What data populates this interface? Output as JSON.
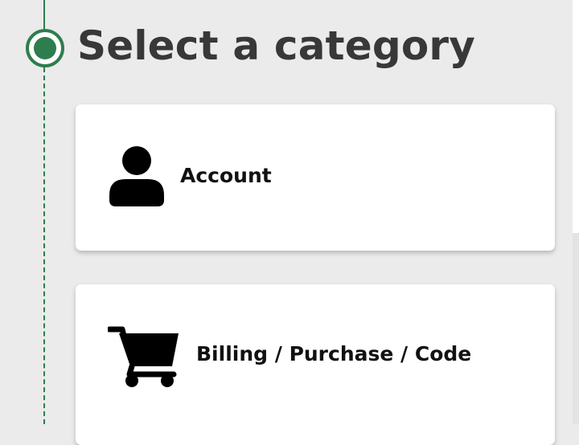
{
  "header": {
    "title": "Select a category"
  },
  "categories": [
    {
      "label": "Account",
      "icon": "person-icon"
    },
    {
      "label": "Billing / Purchase / Code",
      "icon": "shopping-cart-icon"
    }
  ],
  "colors": {
    "accent": "#2e7d4f",
    "background": "#ebebeb",
    "card": "#ffffff",
    "title_text": "#383838",
    "label_text": "#111111"
  }
}
